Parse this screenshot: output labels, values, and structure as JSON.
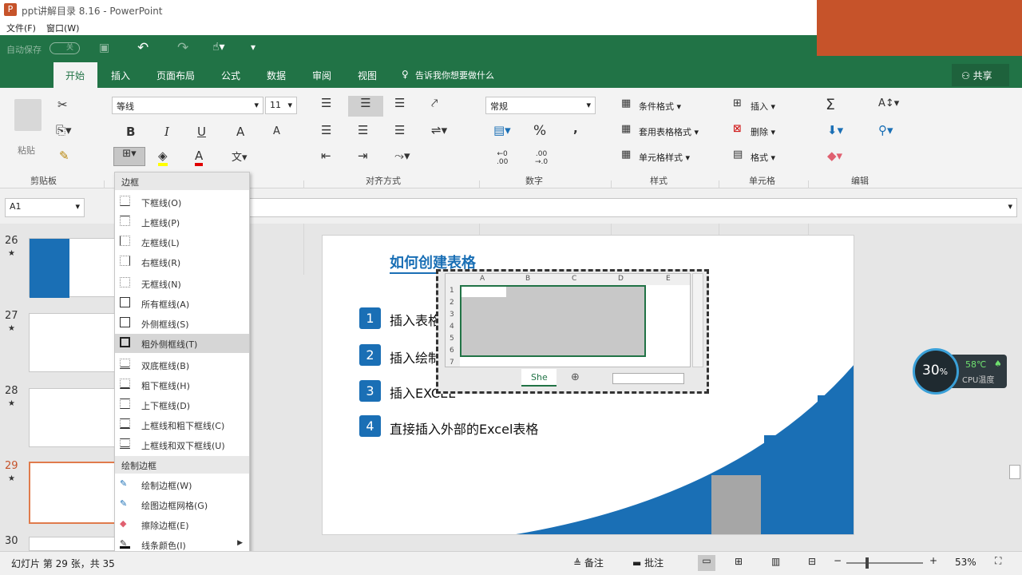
{
  "window": {
    "title": "ppt讲解目录 8.16 - PowerPoint"
  },
  "menu": [
    "文件(F)",
    "窗口(W)"
  ],
  "qat": {
    "autosave": "自动保存",
    "toggle": "关"
  },
  "tabs": [
    "开始",
    "插入",
    "页面布局",
    "公式",
    "数据",
    "审阅",
    "视图"
  ],
  "tellme": "告诉我你想要做什么",
  "share": "共享",
  "ribbon": {
    "paste": "粘贴",
    "clipboard": "剪贴板",
    "font_name": "等线",
    "font_size": "11",
    "align_group": "对齐方式",
    "number_format": "常规",
    "number_group": "数字",
    "cond_format": "条件格式",
    "table_format": "套用表格格式",
    "cell_style": "单元格样式",
    "styles_group": "样式",
    "insert": "插入",
    "delete": "删除",
    "format": "格式",
    "cells_group": "单元格",
    "edit_group": "编辑",
    "bold": "B",
    "italic": "I",
    "underline": "U",
    "percent": "%",
    "comma": ",",
    "sigma": "Σ"
  },
  "namebox": "A1",
  "slides": [
    {
      "num": "26"
    },
    {
      "num": "27"
    },
    {
      "num": "28"
    },
    {
      "num": "29"
    },
    {
      "num": "30"
    }
  ],
  "slide": {
    "title": "如何创建表格",
    "items": [
      {
        "num": "1",
        "text": "插入表格"
      },
      {
        "num": "2",
        "text": "插入绘制"
      },
      {
        "num": "3",
        "text": "插入EXCEL"
      },
      {
        "num": "4",
        "text": "直接插入外部的Excel表格"
      }
    ],
    "embed": {
      "cols": [
        "A",
        "B",
        "C",
        "D",
        "E"
      ],
      "rows": [
        "1",
        "2",
        "3",
        "4",
        "5",
        "6",
        "7"
      ],
      "sheet": "She"
    }
  },
  "dropdown": {
    "header1": "边框",
    "items1": [
      "下框线(O)",
      "上框线(P)",
      "左框线(L)",
      "右框线(R)",
      "无框线(N)",
      "所有框线(A)",
      "外侧框线(S)",
      "粗外侧框线(T)",
      "双底框线(B)",
      "粗下框线(H)",
      "上下框线(D)",
      "上框线和粗下框线(C)",
      "上框线和双下框线(U)"
    ],
    "header2": "绘制边框",
    "items2": [
      "绘制边框(W)",
      "绘图边框网格(G)",
      "擦除边框(E)",
      "线条颜色(I)"
    ]
  },
  "status": {
    "slide_info": "幻灯片 第 29 张，共 35",
    "notes": "备注",
    "comments": "批注",
    "zoom": "53%"
  },
  "cpu": {
    "percent": "30",
    "unit": "%",
    "temp": "58℃",
    "label": "CPU温度"
  }
}
